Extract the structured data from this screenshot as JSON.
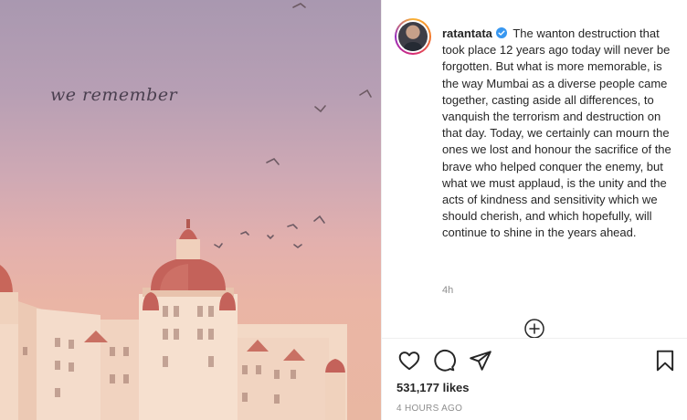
{
  "post": {
    "image_caption": "we remember",
    "colors": {
      "sky_top": "#a998b0",
      "sky_bottom": "#e9b7a2",
      "dome": "#c8665a",
      "building": "#f3d9c6"
    }
  },
  "comment": {
    "username": "ratantata",
    "verified": true,
    "text": "The wanton destruction that took place 12 years ago today will never be forgotten. But what is more memorable, is the way Mumbai as a diverse people came together, casting aside all differences, to vanquish the terrorism and destruction on that day. Today, we certainly can mourn the ones we lost and honour the sacrifice of the brave who helped conquer the enemy, but what we must applaud, is the unity and the acts of kindness and sensitivity which we should cherish, and which hopefully, will continue to shine in the years ahead.",
    "time": "4h"
  },
  "actions": {
    "icons": [
      "heart-icon",
      "comment-icon",
      "share-icon",
      "bookmark-icon"
    ],
    "load_more_icon": "plus-circle-icon"
  },
  "likes": "531,177 likes",
  "time_ago": "4 HOURS AGO"
}
